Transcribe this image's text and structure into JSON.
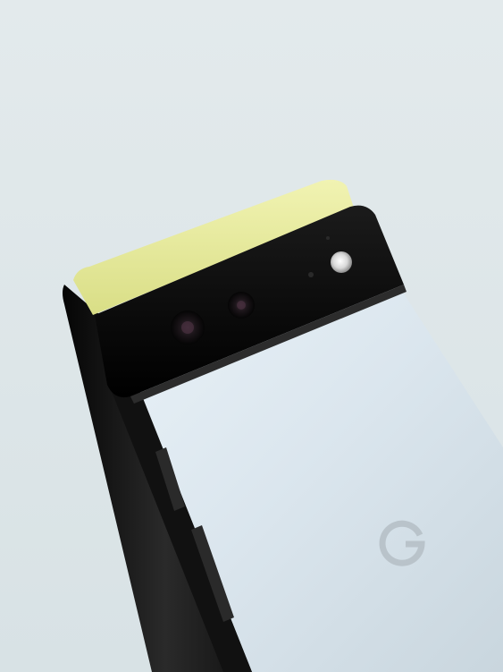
{
  "image": {
    "subject": "phone-rear-view",
    "logo_glyph": "G",
    "colors": {
      "background": "#dfe8ea",
      "frame": "#121212",
      "back_panel": "#dde8ef",
      "camera_bar": "#0c0c0c",
      "top_accent": "#e8ec9a",
      "logo": "#b9c3ca"
    }
  }
}
